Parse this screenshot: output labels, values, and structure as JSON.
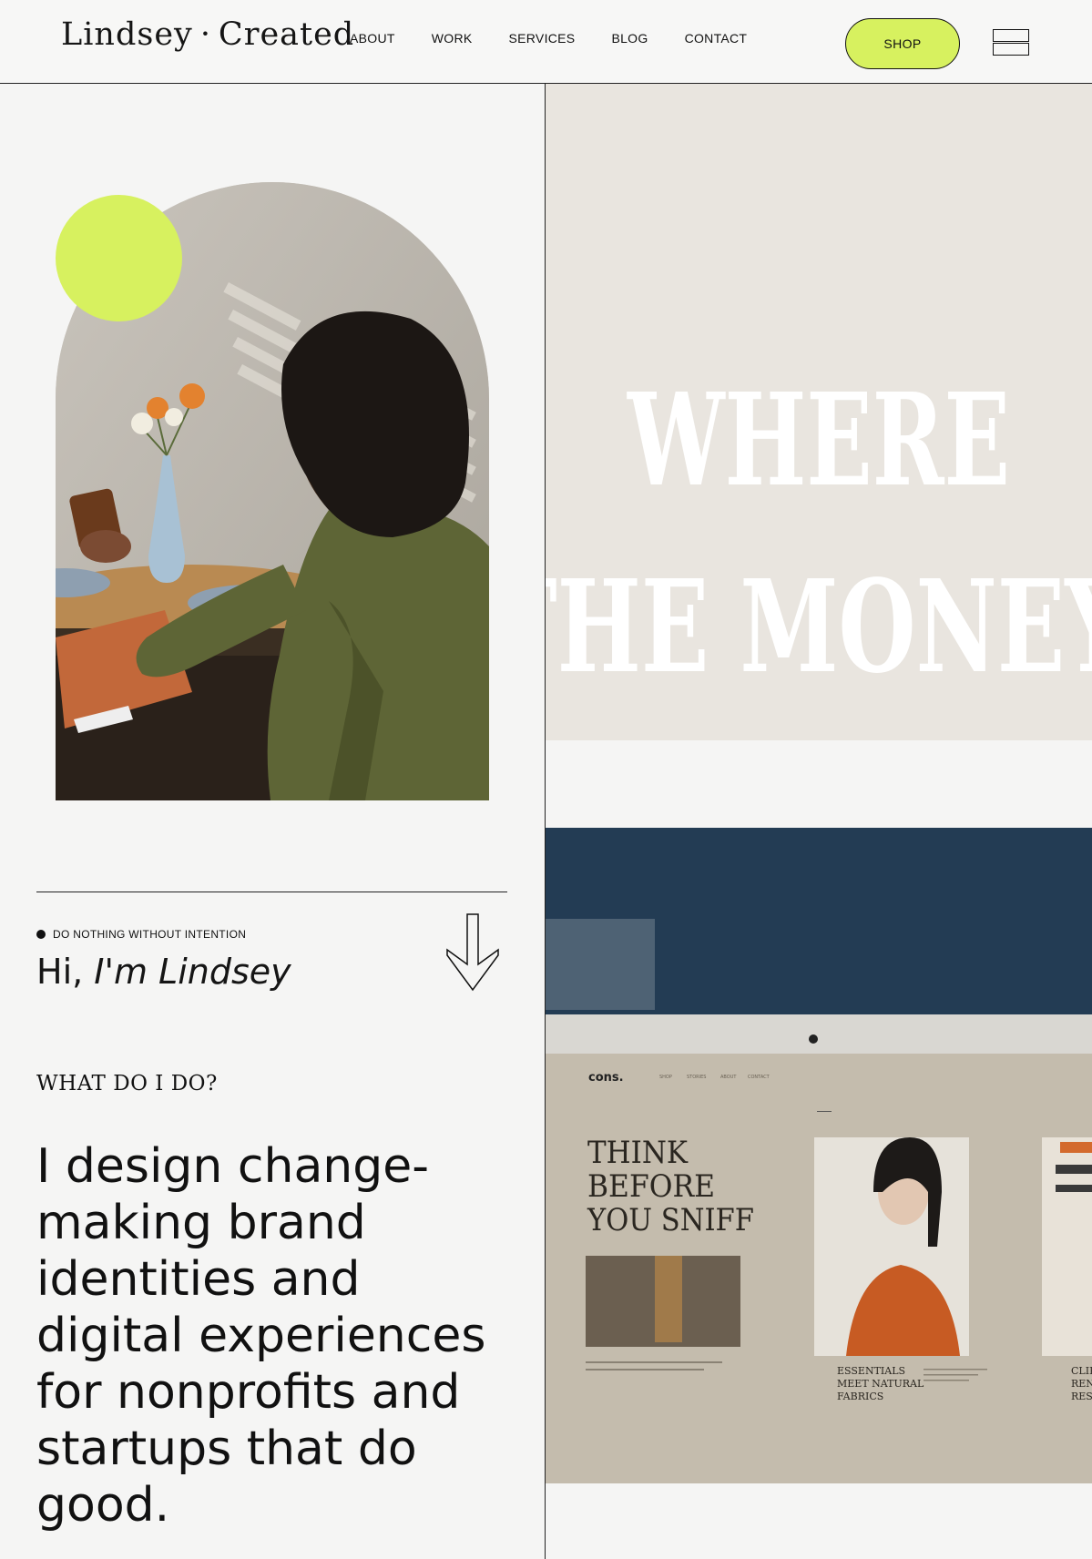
{
  "header": {
    "logo": "Lindsey · Created",
    "nav": [
      "ABOUT",
      "WORK",
      "SERVICES",
      "BLOG",
      "CONTACT"
    ],
    "shop_label": "SHOP"
  },
  "colors": {
    "accent": "#d7f15f",
    "ink": "#111111",
    "background": "#f5f5f4"
  },
  "hero": {
    "tagline": "DO NOTHING WITHOUT INTENTION",
    "greeting_prefix": "Hi, ",
    "greeting_name": "I'm Lindsey",
    "section_heading": "WHAT DO I DO?",
    "intro": "I design change-making brand identities and digital experiences for nonprofits and startups that do good."
  },
  "poster": {
    "line1": "WHERE",
    "line2": "THE MONEY"
  },
  "laptop_mockup": {
    "brand": "cons.",
    "headline_lines": [
      "THINK",
      "BEFORE",
      "YOU SNIFF"
    ],
    "caption_lines": [
      "ESSENTIALS",
      "MEET NATURAL",
      "FABRICS"
    ],
    "side_caption_lines": [
      "CLIP",
      "REN",
      "RES"
    ]
  },
  "icons": {
    "arrow": "arrow-down-icon",
    "menu": "hamburger-menu-icon"
  }
}
